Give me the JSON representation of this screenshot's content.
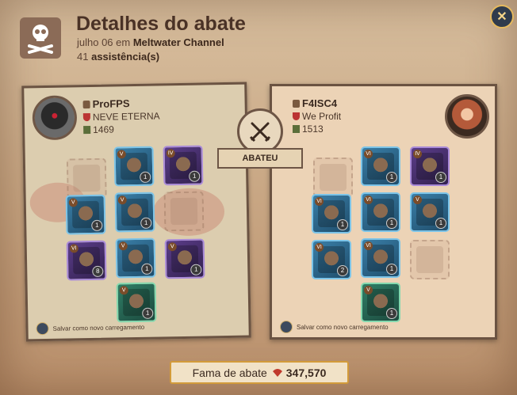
{
  "header": {
    "title": "Detalhes do abate",
    "date_text": "julho 06 em",
    "location": "Meltwater Channel",
    "assist_count": "41",
    "assist_label": "assistência(s)"
  },
  "killer": {
    "name": "ProFPS",
    "guild": "NEVE ETERNA",
    "item_power": "1469",
    "equipment": [
      {
        "slot": "bag",
        "empty": true
      },
      {
        "slot": "head",
        "tier": "V",
        "qty": "1",
        "rarity": "t5"
      },
      {
        "slot": "cape",
        "tier": "IV",
        "qty": "1",
        "rarity": "t6"
      },
      {
        "slot": "main-hand",
        "tier": "V",
        "qty": "1",
        "rarity": "t5"
      },
      {
        "slot": "chest",
        "tier": "V",
        "qty": "1",
        "rarity": "t5"
      },
      {
        "slot": "off-hand",
        "empty": true
      },
      {
        "slot": "potion",
        "tier": "VI",
        "qty": "8",
        "rarity": "t6"
      },
      {
        "slot": "shoes",
        "tier": "V",
        "qty": "1",
        "rarity": "t5"
      },
      {
        "slot": "food",
        "tier": "V",
        "qty": "1",
        "rarity": "t6"
      },
      {
        "slot": "mount",
        "tier": "V",
        "qty": "1",
        "rarity": "t8"
      }
    ],
    "save_label": "Salvar como novo carregamento"
  },
  "victim": {
    "name": "F4ISC4",
    "guild": "We Profit",
    "item_power": "1513",
    "equipment": [
      {
        "slot": "bag",
        "empty": true
      },
      {
        "slot": "head",
        "tier": "VI",
        "qty": "1",
        "rarity": "t5"
      },
      {
        "slot": "cape",
        "tier": "IV",
        "qty": "1",
        "rarity": "t6"
      },
      {
        "slot": "main-hand",
        "tier": "VI",
        "qty": "1",
        "rarity": "t5"
      },
      {
        "slot": "chest",
        "tier": "VI",
        "qty": "1",
        "rarity": "t5"
      },
      {
        "slot": "off-hand",
        "tier": "V",
        "qty": "1",
        "rarity": "t5"
      },
      {
        "slot": "potion",
        "tier": "VI",
        "qty": "2",
        "rarity": "t5"
      },
      {
        "slot": "shoes",
        "tier": "VI",
        "qty": "1",
        "rarity": "t5"
      },
      {
        "slot": "food",
        "empty": true
      },
      {
        "slot": "mount",
        "tier": "V",
        "qty": "1",
        "rarity": "t8"
      }
    ],
    "save_label": "Salvar como novo carregamento"
  },
  "killed_label": "ABATEU",
  "fame": {
    "label": "Fama de abate",
    "value": "347,570"
  },
  "colors": {
    "title": "#4a3226",
    "fame_border": "#d39b3a"
  }
}
